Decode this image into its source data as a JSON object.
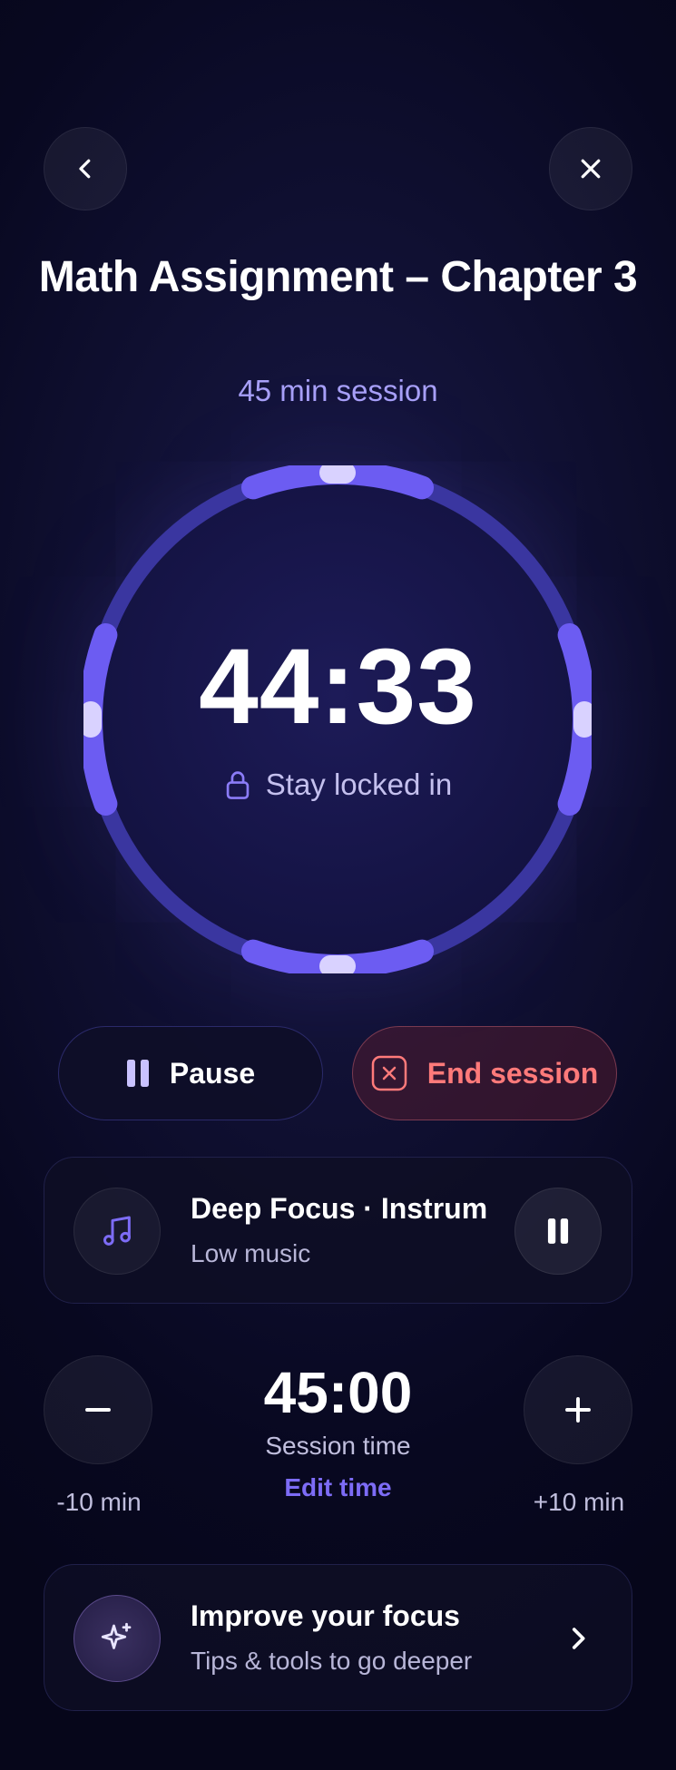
{
  "header": {
    "back_icon": "chevron-left-icon",
    "close_icon": "close-icon"
  },
  "session": {
    "title": "Math Assignment – Chapter 3",
    "subtitle": "45 min session",
    "countdown": "44:33",
    "lock_text": "Stay locked in",
    "progress_fraction": 0.99
  },
  "controls": {
    "pause_label": "Pause",
    "end_label": "End session"
  },
  "music": {
    "track_title": "Deep Focus · Instrumental",
    "volume_text": "Low music"
  },
  "duration": {
    "value": "45:00",
    "label": "Session time",
    "edit_label": "Edit time",
    "decrease_label": "-10 min",
    "increase_label": "+10 min"
  },
  "focus_card": {
    "title": "Improve your focus",
    "subtitle": "Tips & tools to go deeper"
  },
  "colors": {
    "accent": "#6c5cf2",
    "accent_light": "#a8a0f8",
    "danger": "#ff7a7a",
    "background": "#0b0b26"
  }
}
